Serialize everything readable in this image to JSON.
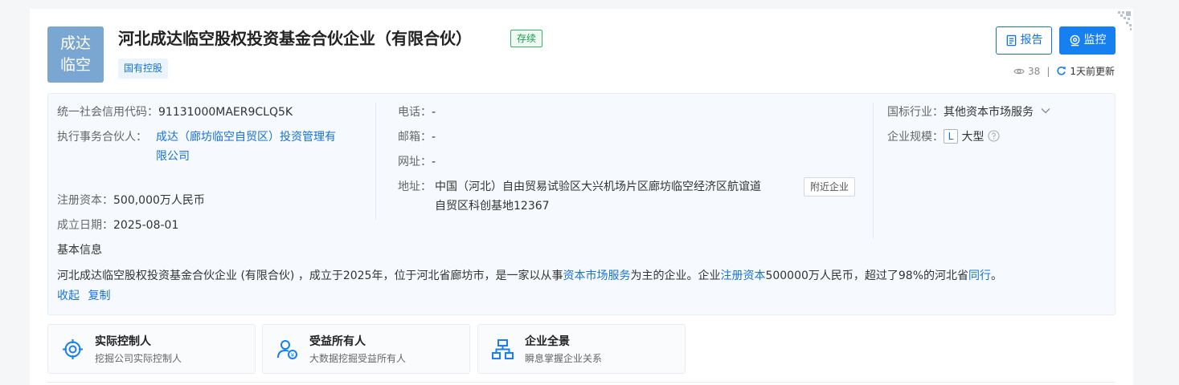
{
  "company": {
    "logo_text_line1": "成达",
    "logo_text_line2": "临空",
    "name": "河北成达临空股权投资基金合伙企业（有限合伙）",
    "status": "存续",
    "tag": "国有控股"
  },
  "actions": {
    "report_label": "报告",
    "monitor_label": "监控",
    "views": "38",
    "updated": "1天前更新"
  },
  "info": {
    "credit_code_label": "统一社会信用代码：",
    "credit_code": "91131000MAER9CLQ5K",
    "partner_label": "执行事务合伙人：",
    "partner_line1": "成达（廊坊临空自贸区）投资管理有",
    "partner_line2": "限公司",
    "capital_label": "注册资本：",
    "capital": "500,000万人民币",
    "date_label": "成立日期：",
    "date": "2025-08-01",
    "phone_label": "电话：",
    "phone": "-",
    "email_label": "邮箱：",
    "email": "-",
    "website_label": "网址：",
    "website": "-",
    "address_label": "地址：",
    "address_line1": "中国（河北）自由贸易试验区大兴机场片区廊坊临空经济区航谊道",
    "address_line2": "自贸区科创基地12367",
    "nearby_label": "附近企业",
    "industry_label": "国标行业：",
    "industry": "其他资本市场服务",
    "scale_label": "企业规模：",
    "scale_badge": "L",
    "scale": "大型",
    "basic_title": "基本信息",
    "desc_part1": "河北成达临空股权投资基金合伙企业 (有限合伙) ，成立于2025年，位于河北省廊坊市，是一家以从事",
    "desc_link1": "资本市场服务",
    "desc_part2": "为主的企业。企业",
    "desc_link2": "注册资本",
    "desc_part3": "500000万人民币，超过了98%的河北省",
    "desc_link3": "同行",
    "desc_part4": "。",
    "collapse_label": "收起",
    "copy_label": "复制"
  },
  "features": [
    {
      "title": "实际控制人",
      "subtitle": "挖掘公司实际控制人",
      "icon": "target-icon"
    },
    {
      "title": "受益所有人",
      "subtitle": "大数据挖掘受益所有人",
      "icon": "beneficiary-icon"
    },
    {
      "title": "企业全景",
      "subtitle": "瞬息掌握企业关系",
      "icon": "org-chart-icon"
    }
  ],
  "colors": {
    "primary": "#1680f0",
    "link": "#1672d8",
    "status_green": "#1c9a4f",
    "logo_bg": "#7aa6d2"
  }
}
